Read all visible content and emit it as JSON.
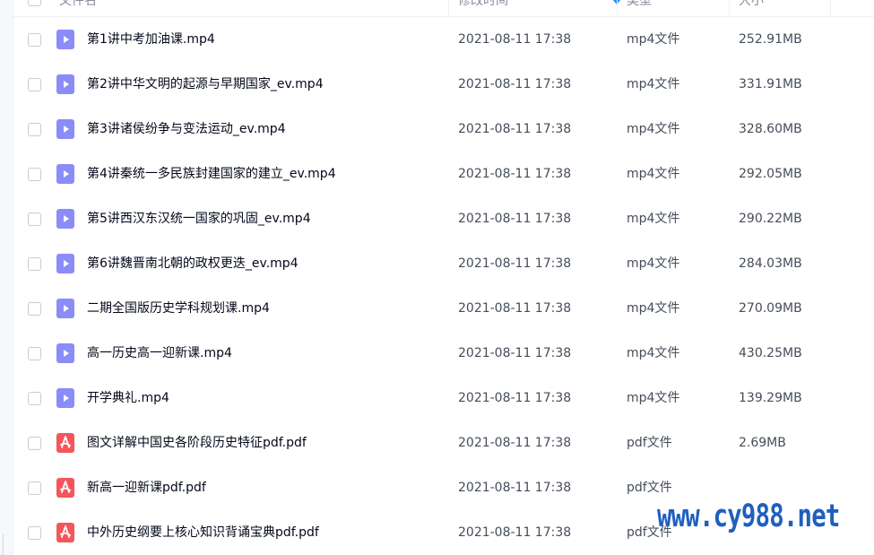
{
  "header": {
    "name_label": "文件名",
    "date_label": "修改时间",
    "type_label": "类型",
    "size_label": "大小"
  },
  "files": [
    {
      "name": "第1讲中考加油课.mp4",
      "date": "2021-08-11 17:38",
      "type": "mp4文件",
      "size": "252.91MB",
      "icon": "video-file-icon"
    },
    {
      "name": "第2讲中华文明的起源与早期国家_ev.mp4",
      "date": "2021-08-11 17:38",
      "type": "mp4文件",
      "size": "331.91MB",
      "icon": "video-file-icon"
    },
    {
      "name": "第3讲诸侯纷争与变法运动_ev.mp4",
      "date": "2021-08-11 17:38",
      "type": "mp4文件",
      "size": "328.60MB",
      "icon": "video-file-icon"
    },
    {
      "name": "第4讲秦统一多民族封建国家的建立_ev.mp4",
      "date": "2021-08-11 17:38",
      "type": "mp4文件",
      "size": "292.05MB",
      "icon": "video-file-icon"
    },
    {
      "name": "第5讲西汉东汉统一国家的巩固_ev.mp4",
      "date": "2021-08-11 17:38",
      "type": "mp4文件",
      "size": "290.22MB",
      "icon": "video-file-icon"
    },
    {
      "name": "第6讲魏晋南北朝的政权更迭_ev.mp4",
      "date": "2021-08-11 17:38",
      "type": "mp4文件",
      "size": "284.03MB",
      "icon": "video-file-icon"
    },
    {
      "name": "二期全国版历史学科规划课.mp4",
      "date": "2021-08-11 17:38",
      "type": "mp4文件",
      "size": "270.09MB",
      "icon": "video-file-icon"
    },
    {
      "name": "高一历史高一迎新课.mp4",
      "date": "2021-08-11 17:38",
      "type": "mp4文件",
      "size": "430.25MB",
      "icon": "video-file-icon"
    },
    {
      "name": "开学典礼.mp4",
      "date": "2021-08-11 17:38",
      "type": "mp4文件",
      "size": "139.29MB",
      "icon": "video-file-icon"
    },
    {
      "name": "图文详解中国史各阶段历史特征pdf.pdf",
      "date": "2021-08-11 17:38",
      "type": "pdf文件",
      "size": "2.69MB",
      "icon": "pdf-file-icon"
    },
    {
      "name": "新高一迎新课pdf.pdf",
      "date": "2021-08-11 17:38",
      "type": "pdf文件",
      "size": "",
      "icon": "pdf-file-icon"
    },
    {
      "name": "中外历史纲要上核心知识背诵宝典pdf.pdf",
      "date": "2021-08-11 17:38",
      "type": "pdf文件",
      "size": "",
      "icon": "pdf-file-icon"
    }
  ],
  "watermark": "www.cy988.net",
  "colors": {
    "video_icon": "#8a8cf8",
    "pdf_icon": "#f4565c",
    "sort_accent": "#2d8cff",
    "watermark": "#1f5fbf"
  }
}
